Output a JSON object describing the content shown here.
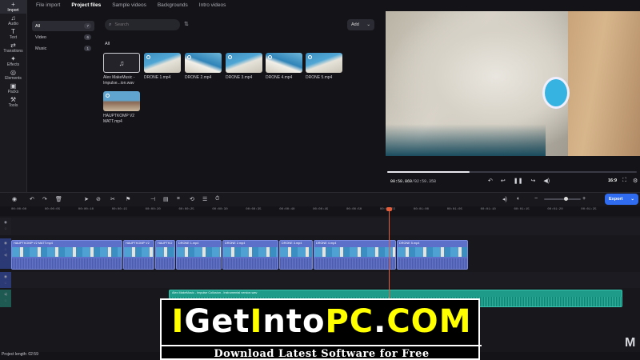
{
  "rail": [
    {
      "label": "Import",
      "icon": "+"
    },
    {
      "label": "Audio",
      "icon": "♫"
    },
    {
      "label": "Text",
      "icon": "T"
    },
    {
      "label": "Transitions",
      "icon": "⇄"
    },
    {
      "label": "Effects",
      "icon": "✦"
    },
    {
      "label": "Elements",
      "icon": "◎"
    },
    {
      "label": "Packs",
      "icon": "▣"
    },
    {
      "label": "Tools",
      "icon": "⚒"
    }
  ],
  "tabs": [
    "File import",
    "Project files",
    "Sample videos",
    "Backgrounds",
    "Intro videos"
  ],
  "categories": [
    {
      "label": "All",
      "count": "7"
    },
    {
      "label": "Video",
      "count": "6"
    },
    {
      "label": "Music",
      "count": "1"
    }
  ],
  "search": {
    "placeholder": "Search"
  },
  "add_label": "Add",
  "files_heading": "All",
  "files": [
    {
      "name": "Alex MakeMusic - Impulse...ion.wav"
    },
    {
      "name": "DRONE 1.mp4"
    },
    {
      "name": "DRONE 2.mp4"
    },
    {
      "name": "DRONE 3.mp4"
    },
    {
      "name": "DRONE 4.mp4"
    },
    {
      "name": "DRONE 5.mp4"
    },
    {
      "name": "HAUPTKOMP V2 MATT.mp4"
    }
  ],
  "player": {
    "current_time": "00:58.869",
    "total_time": "/02:59.358",
    "progress": 0.33,
    "aspect": "16:9"
  },
  "ruler_ticks": [
    "00:00:00",
    "00:00:05",
    "00:00:10",
    "00:00:15",
    "00:00:20",
    "00:00:25",
    "00:00:30",
    "00:00:35",
    "00:00:40",
    "00:00:45",
    "00:00:50",
    "00:00:55",
    "00:01:00",
    "00:01:05",
    "00:01:10",
    "00:01:15",
    "00:01:20",
    "00:01:25"
  ],
  "clips": [
    {
      "label": "HAUPTKOMP V2 MATT.mp4"
    },
    {
      "label": "HAUPTKOMP V2"
    },
    {
      "label": "HAUPTKO"
    },
    {
      "label": "DRONE 1.mp4"
    },
    {
      "label": "DRONE 2.mp4"
    },
    {
      "label": "DRONE 3.mp4"
    },
    {
      "label": "DRONE 4.mp4"
    },
    {
      "label": "DRONE 5.mp4"
    }
  ],
  "audio_clip": {
    "label": "Alex MakeMusic - Impulse Collusion - Instrumental version.wav"
  },
  "export_label": "Export",
  "project_length": "Project length: 02:59",
  "zoom_level": 0.6,
  "watermark": {
    "logo_parts": [
      "I",
      "Get",
      "I",
      "nto",
      "PC",
      ".",
      "COM"
    ],
    "tagline": "Download Latest Software for Free"
  },
  "corner_mark": "M"
}
